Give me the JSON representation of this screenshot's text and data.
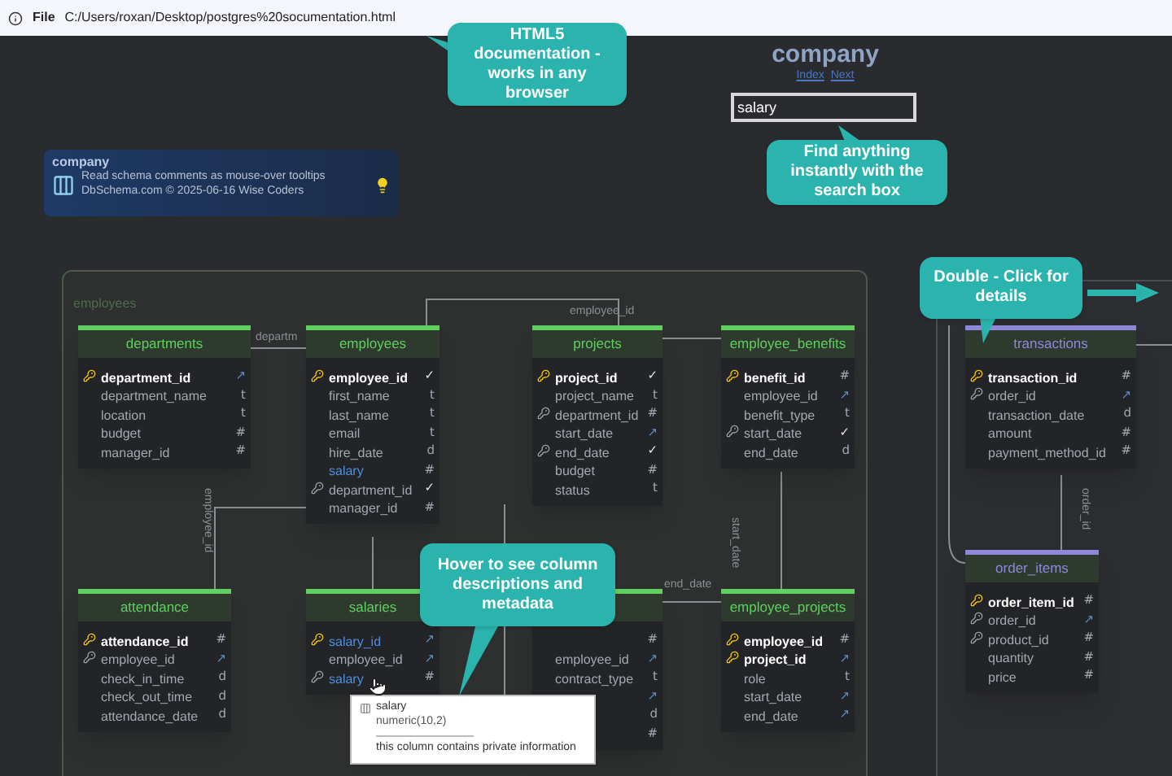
{
  "address_bar": {
    "scheme": "File",
    "path": "C:/Users/roxan/Desktop/postgres%20socumentation.html"
  },
  "header": {
    "title": "company",
    "links": [
      "Index",
      "Next"
    ],
    "search": {
      "value": "salary"
    }
  },
  "info_card": {
    "title": "company",
    "lines": [
      "Read schema comments as mouse-over tooltips",
      "DbSchema.com © 2025-06-16 Wise Coders"
    ]
  },
  "callouts": [
    "HTML5 documentation - works in any browser",
    "Find anything instantly with the search box",
    "Double - Click for details",
    "Hover to see column descriptions and metadata"
  ],
  "groups": [
    {
      "label": "employees"
    }
  ],
  "relation_labels": [
    {
      "text": "departm",
      "vertical": false
    },
    {
      "text": "employee_id",
      "vertical": false
    },
    {
      "text": "end_date",
      "vertical": false
    },
    {
      "text": "employee_id",
      "vertical": true
    },
    {
      "text": "start_date",
      "vertical": true
    },
    {
      "text": "order_id",
      "vertical": true
    }
  ],
  "tables": [
    {
      "title": "departments",
      "color": "#5fcf5f",
      "rows": [
        {
          "name": "department_id",
          "kind": "primary_key",
          "highlighted": false,
          "tag": "↗"
        },
        {
          "name": "department_name",
          "kind": "column",
          "highlighted": false,
          "tag": "t"
        },
        {
          "name": "location",
          "kind": "column",
          "highlighted": false,
          "tag": "t"
        },
        {
          "name": "budget",
          "kind": "column",
          "highlighted": false,
          "tag": "#"
        },
        {
          "name": "manager_id",
          "kind": "column",
          "highlighted": false,
          "tag": "#"
        }
      ]
    },
    {
      "title": "employees",
      "color": "#5fcf5f",
      "rows": [
        {
          "name": "employee_id",
          "kind": "primary_key",
          "highlighted": false,
          "tag": "✓"
        },
        {
          "name": "first_name",
          "kind": "column",
          "highlighted": false,
          "tag": "t"
        },
        {
          "name": "last_name",
          "kind": "column",
          "highlighted": false,
          "tag": "t"
        },
        {
          "name": "email",
          "kind": "column",
          "highlighted": false,
          "tag": "t"
        },
        {
          "name": "hire_date",
          "kind": "column",
          "highlighted": false,
          "tag": "d"
        },
        {
          "name": "salary",
          "kind": "column",
          "highlighted": true,
          "tag": "#"
        },
        {
          "name": "department_id",
          "kind": "foreign_key",
          "highlighted": false,
          "tag": "✓"
        },
        {
          "name": "manager_id",
          "kind": "column",
          "highlighted": false,
          "tag": "#"
        }
      ]
    },
    {
      "title": "projects",
      "color": "#5fcf5f",
      "rows": [
        {
          "name": "project_id",
          "kind": "primary_key",
          "highlighted": false,
          "tag": "✓"
        },
        {
          "name": "project_name",
          "kind": "column",
          "highlighted": false,
          "tag": "t"
        },
        {
          "name": "department_id",
          "kind": "foreign_key",
          "highlighted": false,
          "tag": "#"
        },
        {
          "name": "start_date",
          "kind": "column",
          "highlighted": false,
          "tag": "↗"
        },
        {
          "name": "end_date",
          "kind": "foreign_key",
          "highlighted": false,
          "tag": "✓"
        },
        {
          "name": "budget",
          "kind": "column",
          "highlighted": false,
          "tag": "#"
        },
        {
          "name": "status",
          "kind": "column",
          "highlighted": false,
          "tag": "t"
        }
      ]
    },
    {
      "title": "employee_benefits",
      "color": "#5fcf5f",
      "rows": [
        {
          "name": "benefit_id",
          "kind": "primary_key",
          "highlighted": false,
          "tag": "#"
        },
        {
          "name": "employee_id",
          "kind": "column",
          "highlighted": false,
          "tag": "↗"
        },
        {
          "name": "benefit_type",
          "kind": "column",
          "highlighted": false,
          "tag": "t"
        },
        {
          "name": "start_date",
          "kind": "foreign_key",
          "highlighted": false,
          "tag": "✓"
        },
        {
          "name": "end_date",
          "kind": "column",
          "highlighted": false,
          "tag": "d"
        }
      ]
    },
    {
      "title": "transactions",
      "color": "#8f87d9",
      "rows": [
        {
          "name": "transaction_id",
          "kind": "primary_key",
          "highlighted": false,
          "tag": "#"
        },
        {
          "name": "order_id",
          "kind": "foreign_key",
          "highlighted": false,
          "tag": "↗"
        },
        {
          "name": "transaction_date",
          "kind": "column",
          "highlighted": false,
          "tag": "d"
        },
        {
          "name": "amount",
          "kind": "column",
          "highlighted": false,
          "tag": "#"
        },
        {
          "name": "payment_method_id",
          "kind": "column",
          "highlighted": false,
          "tag": "#"
        }
      ]
    },
    {
      "title": "attendance",
      "color": "#5fcf5f",
      "rows": [
        {
          "name": "attendance_id",
          "kind": "primary_key",
          "highlighted": false,
          "tag": "#"
        },
        {
          "name": "employee_id",
          "kind": "foreign_key",
          "highlighted": false,
          "tag": "↗"
        },
        {
          "name": "check_in_time",
          "kind": "column",
          "highlighted": false,
          "tag": "d"
        },
        {
          "name": "check_out_time",
          "kind": "column",
          "highlighted": false,
          "tag": "d"
        },
        {
          "name": "attendance_date",
          "kind": "column",
          "highlighted": false,
          "tag": "d"
        }
      ]
    },
    {
      "title": "salaries",
      "color": "#5fcf5f",
      "rows": [
        {
          "name": "salary_id",
          "kind": "primary_key",
          "highlighted": true,
          "tag": "↗"
        },
        {
          "name": "employee_id",
          "kind": "column",
          "highlighted": false,
          "tag": "↗"
        },
        {
          "name": "salary",
          "kind": "foreign_key",
          "highlighted": true,
          "tag": "#"
        }
      ]
    },
    {
      "color": "#5fcf5f",
      "rows": [
        {
          "kind": "column",
          "tag": "#"
        },
        {
          "name": "employee_id",
          "kind": "column",
          "highlighted": false,
          "tag": "↗"
        },
        {
          "name": "contract_type",
          "kind": "column",
          "highlighted": false,
          "tag": "t"
        },
        {
          "kind": "column",
          "tag": "↗"
        },
        {
          "kind": "column",
          "tag": "d"
        },
        {
          "kind": "column",
          "tag": "#"
        }
      ]
    },
    {
      "title": "employee_projects",
      "color": "#5fcf5f",
      "rows": [
        {
          "name": "employee_id",
          "kind": "primary_key",
          "highlighted": false,
          "tag": "#"
        },
        {
          "name": "project_id",
          "kind": "primary_key",
          "highlighted": false,
          "tag": "↗"
        },
        {
          "name": "role",
          "kind": "column",
          "highlighted": false,
          "tag": "t"
        },
        {
          "name": "start_date",
          "kind": "column",
          "highlighted": false,
          "tag": "↗"
        },
        {
          "name": "end_date",
          "kind": "column",
          "highlighted": false,
          "tag": "↗"
        }
      ]
    },
    {
      "title": "order_items",
      "color": "#8f87d9",
      "rows": [
        {
          "name": "order_item_id",
          "kind": "primary_key",
          "highlighted": false,
          "tag": "#"
        },
        {
          "name": "order_id",
          "kind": "foreign_key",
          "highlighted": false,
          "tag": "↗"
        },
        {
          "name": "product_id",
          "kind": "foreign_key",
          "highlighted": false,
          "tag": "#"
        },
        {
          "name": "quantity",
          "kind": "column",
          "highlighted": false,
          "tag": "#"
        },
        {
          "name": "price",
          "kind": "column",
          "highlighted": false,
          "tag": "#"
        }
      ]
    }
  ],
  "tooltip": {
    "column": "salary",
    "type": "numeric(10,2)",
    "comment": "this column contains private information"
  }
}
